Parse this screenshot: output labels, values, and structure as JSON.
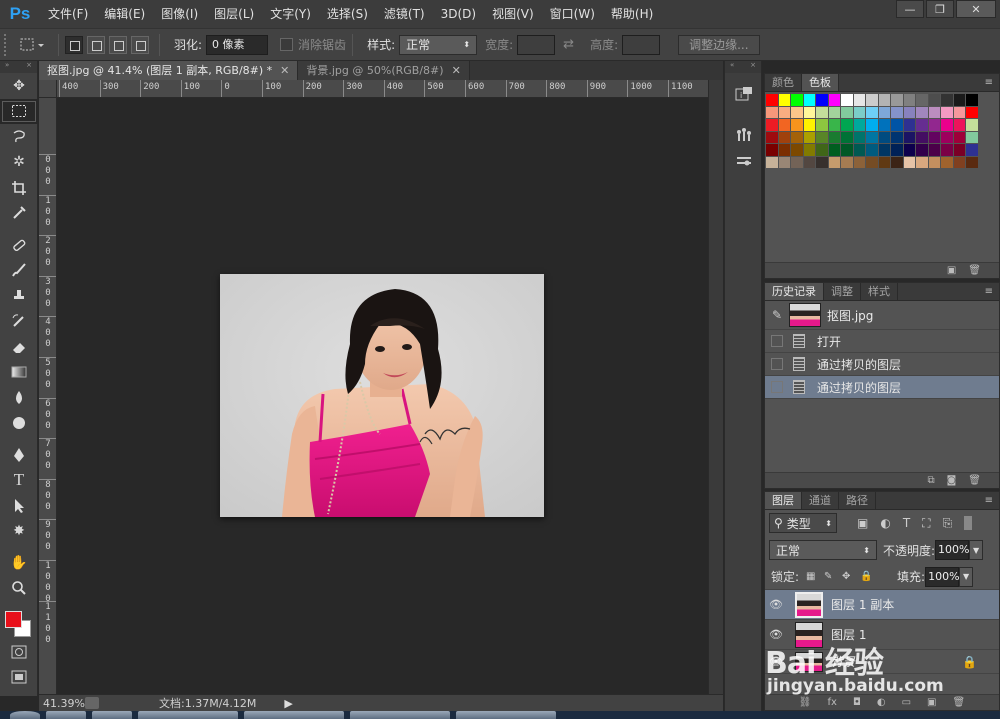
{
  "app": {
    "logo": "Ps"
  },
  "menu": [
    "文件(F)",
    "编辑(E)",
    "图像(I)",
    "图层(L)",
    "文字(Y)",
    "选择(S)",
    "滤镜(T)",
    "3D(D)",
    "视图(V)",
    "窗口(W)",
    "帮助(H)"
  ],
  "window_controls": {
    "minimize": "—",
    "restore": "❐",
    "close": "✕"
  },
  "options": {
    "feather_label": "羽化:",
    "feather_value": "0 像素",
    "antialias_label": "消除锯齿",
    "style_label": "样式:",
    "style_value": "正常",
    "width_label": "宽度:",
    "height_label": "高度:",
    "refine_button": "调整边缘..."
  },
  "tabs": [
    {
      "label": "抠图.jpg @ 41.4% (图层 1 副本, RGB/8#) *",
      "close": "✕"
    },
    {
      "label": "背景.jpg @ 50%(RGB/8#)",
      "close": "✕"
    }
  ],
  "ruler_h": [
    "400",
    "300",
    "200",
    "100",
    "0",
    "100",
    "200",
    "300",
    "400",
    "500",
    "600",
    "700",
    "800",
    "900",
    "1000",
    "1100"
  ],
  "ruler_v": [
    "0\n0\n0",
    "1\n0\n0",
    "2\n0\n0",
    "3\n0\n0",
    "4\n0\n0",
    "5\n0\n0",
    "6\n0\n0",
    "7\n0\n0",
    "8\n0\n0",
    "9\n0\n0",
    "1\n0\n0\n0",
    "1\n1\n0\n0"
  ],
  "status": {
    "zoom": "41.39%",
    "doc_info": "文档:1.37M/4.12M",
    "arrow": "▶"
  },
  "colors": {
    "foreground": "#e8101a",
    "background": "#ffffff",
    "selection": "#6f7c8f"
  },
  "panels": {
    "swatches": {
      "tabs": [
        "颜色",
        "色板"
      ],
      "active": 1
    },
    "history": {
      "tabs": [
        "历史记录",
        "调整",
        "样式"
      ],
      "active": 0,
      "snapshot": "抠图.jpg",
      "steps": [
        {
          "label": "打开",
          "selected": false
        },
        {
          "label": "通过拷贝的图层",
          "selected": false
        },
        {
          "label": "通过拷贝的图层",
          "selected": true
        }
      ]
    },
    "layers": {
      "tabs": [
        "图层",
        "通道",
        "路径"
      ],
      "active": 0,
      "filter_label": "类型",
      "blend_mode": "正常",
      "opacity_label": "不透明度:",
      "opacity_value": "100%",
      "lock_label": "锁定:",
      "fill_label": "填充:",
      "fill_value": "100%",
      "items": [
        {
          "name": "图层 1 副本",
          "selected": true
        },
        {
          "name": "图层 1",
          "selected": false
        },
        {
          "name": "背景",
          "selected": false
        }
      ]
    }
  },
  "watermark": {
    "brand": "Bai 经验",
    "url": "jingyan.baidu.com"
  },
  "swatch_colors": [
    "#ff0000",
    "#ffff00",
    "#00ff00",
    "#00ffff",
    "#0000ff",
    "#ff00ff",
    "#ffffff",
    "#e6e6e6",
    "#cccccc",
    "#b3b3b3",
    "#999999",
    "#808080",
    "#666666",
    "#4d4d4d",
    "#333333",
    "#1a1a1a",
    "#000000",
    "#f7977a",
    "#f9ad81",
    "#fdc68a",
    "#fff79a",
    "#c4df9b",
    "#a3d39c",
    "#82ca9d",
    "#7bcdc8",
    "#6ecff6",
    "#7ea7d8",
    "#8493ca",
    "#8882be",
    "#a187be",
    "#bc8dbf",
    "#f49ac2",
    "#f6989d",
    "#ff0000",
    "#ed1c24",
    "#f26522",
    "#f7941d",
    "#fff200",
    "#8dc63f",
    "#39b54a",
    "#00a651",
    "#00a99d",
    "#00aeef",
    "#0072bc",
    "#0054a6",
    "#2e3192",
    "#662d91",
    "#92278f",
    "#ec008c",
    "#ed145b",
    "#c4df9b",
    "#9e0b0f",
    "#a0410d",
    "#a36209",
    "#aba000",
    "#598527",
    "#1a7b30",
    "#007236",
    "#00746b",
    "#0076a3",
    "#004b80",
    "#003471",
    "#1b1464",
    "#440e62",
    "#630460",
    "#9e005d",
    "#9e0039",
    "#82ca9d",
    "#790000",
    "#7b2e00",
    "#7d4900",
    "#827b00",
    "#406618",
    "#005e20",
    "#005826",
    "#005952",
    "#005b7f",
    "#003663",
    "#002157",
    "#0d004c",
    "#32004b",
    "#4b0049",
    "#7b0046",
    "#7a0026",
    "#2e3192",
    "#c7b299",
    "#998675",
    "#736357",
    "#534741",
    "#37302d",
    "#c69c6d",
    "#a67c52",
    "#8c6239",
    "#754c24",
    "#603913",
    "#3c2416",
    "#e6c3a7",
    "#d9a87f",
    "#c38f5f",
    "#a0632d",
    "#804020",
    "#5a2a10"
  ]
}
